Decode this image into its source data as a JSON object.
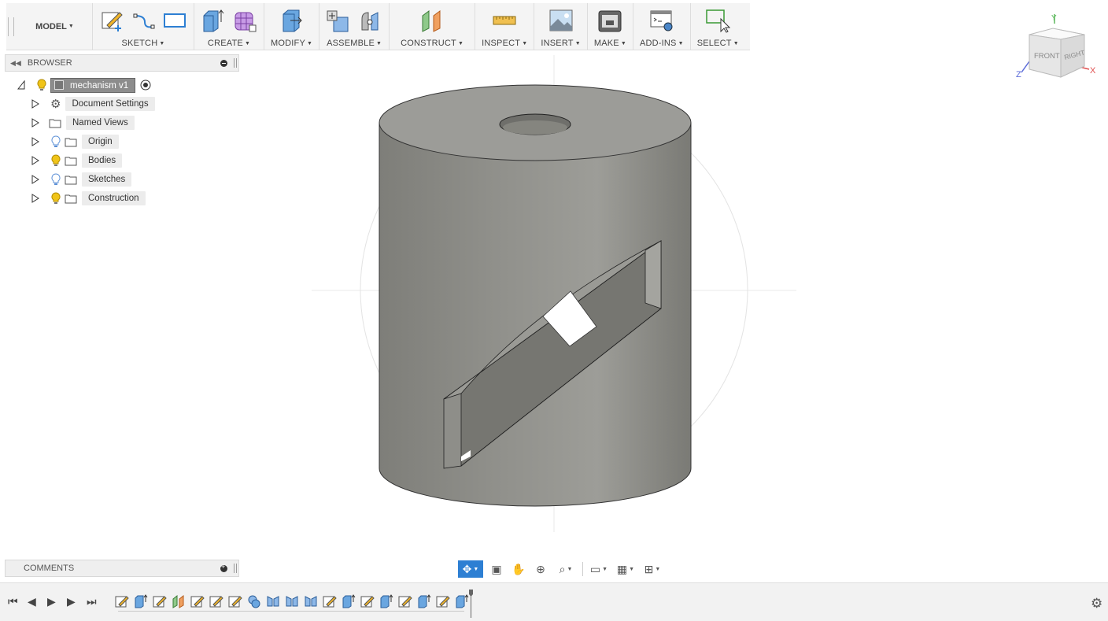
{
  "toolbar": {
    "model_label": "MODEL",
    "groups": [
      {
        "label": "SKETCH"
      },
      {
        "label": "CREATE"
      },
      {
        "label": "MODIFY"
      },
      {
        "label": "ASSEMBLE"
      },
      {
        "label": "CONSTRUCT"
      },
      {
        "label": "INSPECT"
      },
      {
        "label": "INSERT"
      },
      {
        "label": "MAKE"
      },
      {
        "label": "ADD-INS"
      },
      {
        "label": "SELECT"
      }
    ]
  },
  "browser": {
    "title": "BROWSER",
    "root": "mechanism v1",
    "items": [
      {
        "label": "Document Settings",
        "icon": "gear-icon"
      },
      {
        "label": "Named Views",
        "icon": "folder-icon"
      },
      {
        "label": "Origin",
        "icon": "folder-icon",
        "bulb": "off"
      },
      {
        "label": "Bodies",
        "icon": "folder-icon",
        "bulb": "on"
      },
      {
        "label": "Sketches",
        "icon": "folder-icon",
        "bulb": "off"
      },
      {
        "label": "Construction",
        "icon": "folder-icon",
        "bulb": "on"
      }
    ]
  },
  "comments": {
    "title": "COMMENTS"
  },
  "viewcube": {
    "front": "FRONT",
    "right": "RIGHT",
    "axis_x": "X",
    "axis_y": "Y",
    "axis_z": "Z"
  },
  "colors": {
    "accent": "#2d7fd3",
    "bulb_on": "#f0c419",
    "bulb_off": "#8fb5e8",
    "body": "#8e8e89"
  }
}
